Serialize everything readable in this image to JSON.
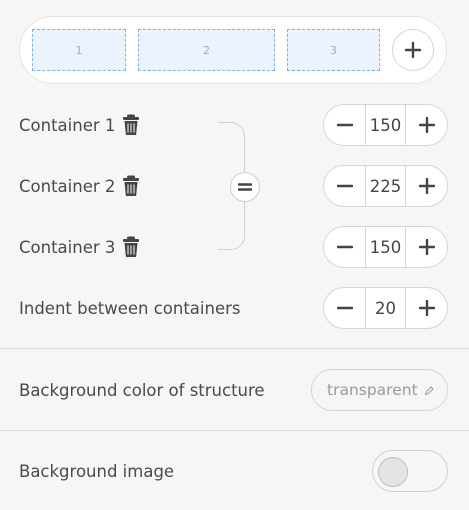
{
  "preview": {
    "slots": [
      "1",
      "2",
      "3"
    ],
    "add_icon": "plus-icon"
  },
  "containers": [
    {
      "label": "Container 1",
      "value": "150",
      "icon": "trash-icon"
    },
    {
      "label": "Container 2",
      "value": "225",
      "icon": "trash-icon"
    },
    {
      "label": "Container 3",
      "value": "150",
      "icon": "trash-icon"
    }
  ],
  "equalize_icon": "equals-icon",
  "indent": {
    "label": "Indent between containers",
    "value": "20"
  },
  "background_color": {
    "label": "Background color of structure",
    "value": "transparent",
    "icon": "pencil-icon"
  },
  "background_image": {
    "label": "Background image",
    "enabled": false
  },
  "colors": {
    "slot_fill": "#eaf3fe",
    "slot_border": "#7fb2e2",
    "page_bg": "#f6f6f6"
  }
}
